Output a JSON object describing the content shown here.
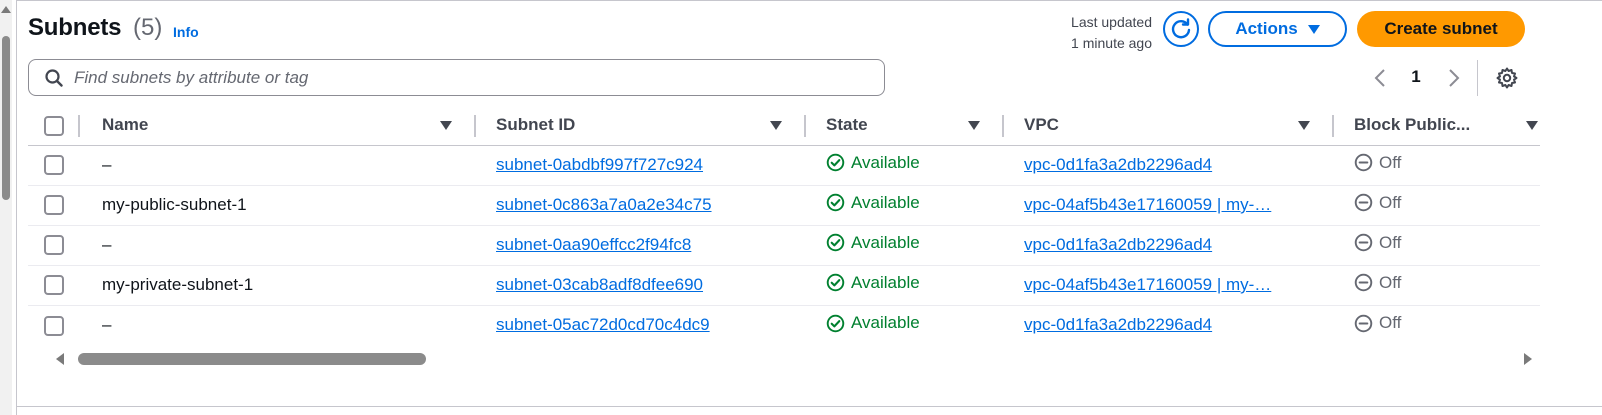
{
  "header": {
    "title": "Subnets",
    "count": "(5)",
    "info_label": "Info",
    "last_updated_line1": "Last updated",
    "last_updated_line2": "1 minute ago",
    "actions_label": "Actions",
    "create_label": "Create subnet"
  },
  "search": {
    "placeholder": "Find subnets by attribute or tag"
  },
  "pagination": {
    "current_page": "1"
  },
  "table": {
    "columns": [
      "Name",
      "Subnet ID",
      "State",
      "VPC",
      "Block Public..."
    ],
    "rows": [
      {
        "name": "–",
        "subnet_id": "subnet-0abdbf997f727c924",
        "state": "Available",
        "vpc": "vpc-0d1fa3a2db2296ad4",
        "block": "Off"
      },
      {
        "name": "my-public-subnet-1",
        "subnet_id": "subnet-0c863a7a0a2e34c75",
        "state": "Available",
        "vpc": "vpc-04af5b43e17160059 | my-…",
        "block": "Off"
      },
      {
        "name": "–",
        "subnet_id": "subnet-0aa90effcc2f94fc8",
        "state": "Available",
        "vpc": "vpc-0d1fa3a2db2296ad4",
        "block": "Off"
      },
      {
        "name": "my-private-subnet-1",
        "subnet_id": "subnet-03cab8adf8dfee690",
        "state": "Available",
        "vpc": "vpc-04af5b43e17160059 | my-…",
        "block": "Off"
      },
      {
        "name": "–",
        "subnet_id": "subnet-05ac72d0cd70c4dc9",
        "state": "Available",
        "vpc": "vpc-0d1fa3a2db2296ad4",
        "block": "Off"
      }
    ]
  },
  "colors": {
    "link": "#006ce0",
    "primary_button": "#ff9900",
    "success": "#00802f",
    "muted": "#656871"
  },
  "icons": {
    "refresh": "refresh-icon",
    "search": "search-icon",
    "settings": "gear-icon",
    "status_available": "check-circle-icon",
    "status_off": "minus-circle-icon"
  }
}
